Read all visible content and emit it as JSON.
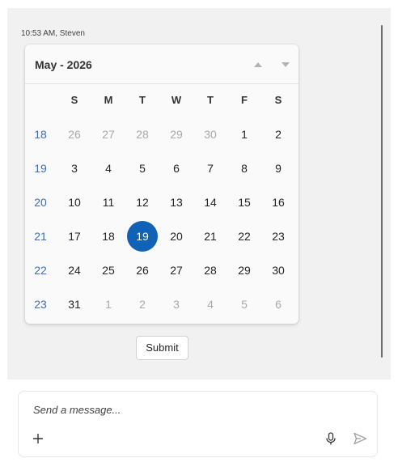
{
  "message_meta": "10:53 AM, Steven",
  "calendar": {
    "month_year": "May - 2026",
    "prev_icon": "triangle-up-icon",
    "next_icon": "triangle-down-icon",
    "weekdays": [
      "S",
      "M",
      "T",
      "W",
      "T",
      "F",
      "S"
    ],
    "weeks": [
      {
        "week": "18",
        "days": [
          {
            "d": "26",
            "muted": true
          },
          {
            "d": "27",
            "muted": true
          },
          {
            "d": "28",
            "muted": true
          },
          {
            "d": "29",
            "muted": true
          },
          {
            "d": "30",
            "muted": true
          },
          {
            "d": "1"
          },
          {
            "d": "2"
          }
        ]
      },
      {
        "week": "19",
        "days": [
          {
            "d": "3"
          },
          {
            "d": "4"
          },
          {
            "d": "5"
          },
          {
            "d": "6"
          },
          {
            "d": "7"
          },
          {
            "d": "8"
          },
          {
            "d": "9"
          }
        ]
      },
      {
        "week": "20",
        "days": [
          {
            "d": "10"
          },
          {
            "d": "11"
          },
          {
            "d": "12"
          },
          {
            "d": "13"
          },
          {
            "d": "14"
          },
          {
            "d": "15"
          },
          {
            "d": "16"
          }
        ]
      },
      {
        "week": "21",
        "days": [
          {
            "d": "17"
          },
          {
            "d": "18"
          },
          {
            "d": "19",
            "selected": true
          },
          {
            "d": "20"
          },
          {
            "d": "21"
          },
          {
            "d": "22"
          },
          {
            "d": "23"
          }
        ]
      },
      {
        "week": "22",
        "days": [
          {
            "d": "24"
          },
          {
            "d": "25"
          },
          {
            "d": "26"
          },
          {
            "d": "27"
          },
          {
            "d": "28"
          },
          {
            "d": "29"
          },
          {
            "d": "30"
          }
        ]
      },
      {
        "week": "23",
        "days": [
          {
            "d": "31"
          },
          {
            "d": "1",
            "muted": true
          },
          {
            "d": "2",
            "muted": true
          },
          {
            "d": "3",
            "muted": true
          },
          {
            "d": "4",
            "muted": true
          },
          {
            "d": "5",
            "muted": true
          },
          {
            "d": "6",
            "muted": true
          }
        ]
      }
    ],
    "colors": {
      "selected": "#0f62b5",
      "week_number": "#3f6fb0",
      "muted": "#a9a9a9"
    }
  },
  "submit_label": "Submit",
  "composer": {
    "placeholder": "Send a message...",
    "add_icon": "plus-icon",
    "mic_icon": "microphone-icon",
    "send_icon": "send-icon"
  }
}
